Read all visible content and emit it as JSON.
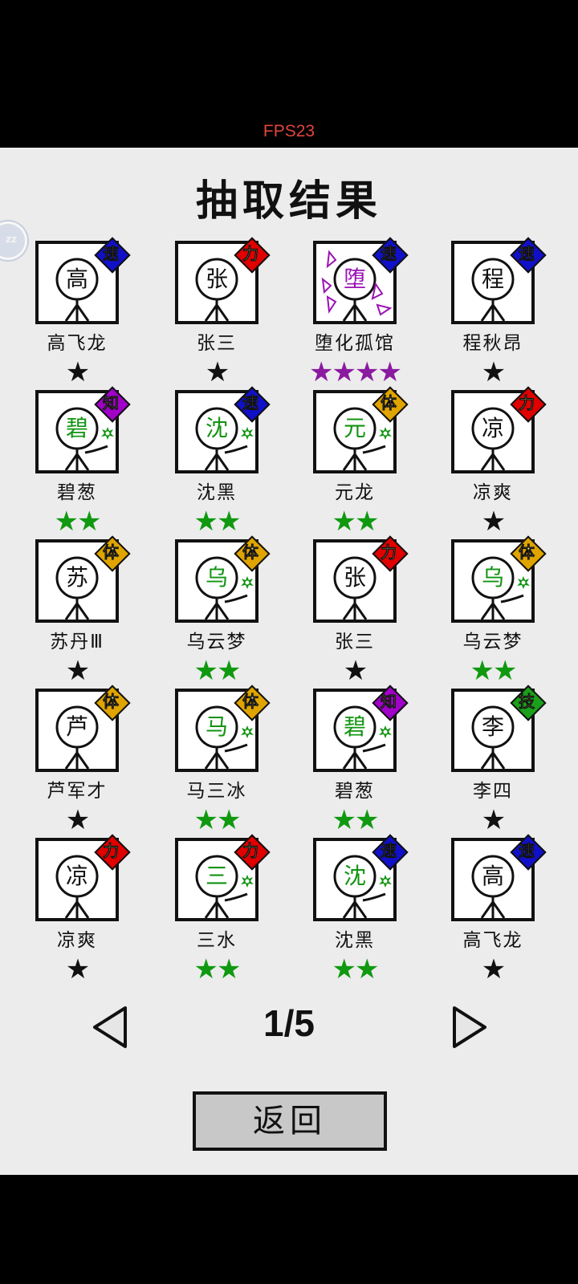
{
  "fps": "FPS23",
  "title": "抽取结果",
  "side_bubble": {
    "label": "zz"
  },
  "colors": {
    "power": "#e00000",
    "speed": "#1010c8",
    "body": "#e0a400",
    "wisdom": "#a000c8",
    "skill": "#1aa01a",
    "star_black": "#111111",
    "star_green": "#109910",
    "star_purple": "#8a1aa0",
    "face_black": "#111111",
    "face_green": "#129412",
    "face_purple": "#9a12b4"
  },
  "cards": [
    {
      "char": "高",
      "name": "高飞龙",
      "badge": "速",
      "badge_color": "speed",
      "stars": "★",
      "star_color": "star_black",
      "face_color": "face_black",
      "held": false,
      "fallen": false
    },
    {
      "char": "张",
      "name": "张三",
      "badge": "力",
      "badge_color": "power",
      "stars": "★",
      "star_color": "star_black",
      "face_color": "face_black",
      "held": false,
      "fallen": false
    },
    {
      "char": "堕",
      "name": "堕化孤馆",
      "badge": "速",
      "badge_color": "speed",
      "stars": "★★★★",
      "star_color": "star_purple",
      "face_color": "face_purple",
      "held": false,
      "fallen": true
    },
    {
      "char": "程",
      "name": "程秋昂",
      "badge": "速",
      "badge_color": "speed",
      "stars": "★",
      "star_color": "star_black",
      "face_color": "face_black",
      "held": false,
      "fallen": false
    },
    {
      "char": "碧",
      "name": "碧葱",
      "badge": "知",
      "badge_color": "wisdom",
      "stars": "★★",
      "star_color": "star_green",
      "face_color": "face_green",
      "held": true,
      "fallen": false
    },
    {
      "char": "沈",
      "name": "沈黑",
      "badge": "速",
      "badge_color": "speed",
      "stars": "★★",
      "star_color": "star_green",
      "face_color": "face_green",
      "held": true,
      "fallen": false
    },
    {
      "char": "元",
      "name": "元龙",
      "badge": "体",
      "badge_color": "body",
      "stars": "★★",
      "star_color": "star_green",
      "face_color": "face_green",
      "held": true,
      "fallen": false
    },
    {
      "char": "凉",
      "name": "凉爽",
      "badge": "力",
      "badge_color": "power",
      "stars": "★",
      "star_color": "star_black",
      "face_color": "face_black",
      "held": false,
      "fallen": false
    },
    {
      "char": "苏",
      "name": "苏丹Ⅲ",
      "badge": "体",
      "badge_color": "body",
      "stars": "★",
      "star_color": "star_black",
      "face_color": "face_black",
      "held": false,
      "fallen": false
    },
    {
      "char": "乌",
      "name": "乌云梦",
      "badge": "体",
      "badge_color": "body",
      "stars": "★★",
      "star_color": "star_green",
      "face_color": "face_green",
      "held": true,
      "fallen": false
    },
    {
      "char": "张",
      "name": "张三",
      "badge": "力",
      "badge_color": "power",
      "stars": "★",
      "star_color": "star_black",
      "face_color": "face_black",
      "held": false,
      "fallen": false
    },
    {
      "char": "乌",
      "name": "乌云梦",
      "badge": "体",
      "badge_color": "body",
      "stars": "★★",
      "star_color": "star_green",
      "face_color": "face_green",
      "held": true,
      "fallen": false
    },
    {
      "char": "芦",
      "name": "芦军才",
      "badge": "体",
      "badge_color": "body",
      "stars": "★",
      "star_color": "star_black",
      "face_color": "face_black",
      "held": false,
      "fallen": false
    },
    {
      "char": "马",
      "name": "马三冰",
      "badge": "体",
      "badge_color": "body",
      "stars": "★★",
      "star_color": "star_green",
      "face_color": "face_green",
      "held": true,
      "fallen": false
    },
    {
      "char": "碧",
      "name": "碧葱",
      "badge": "知",
      "badge_color": "wisdom",
      "stars": "★★",
      "star_color": "star_green",
      "face_color": "face_green",
      "held": true,
      "fallen": false
    },
    {
      "char": "李",
      "name": "李四",
      "badge": "技",
      "badge_color": "skill",
      "stars": "★",
      "star_color": "star_black",
      "face_color": "face_black",
      "held": false,
      "fallen": false
    },
    {
      "char": "凉",
      "name": "凉爽",
      "badge": "力",
      "badge_color": "power",
      "stars": "★",
      "star_color": "star_black",
      "face_color": "face_black",
      "held": false,
      "fallen": false
    },
    {
      "char": "三",
      "name": "三水",
      "badge": "力",
      "badge_color": "power",
      "stars": "★★",
      "star_color": "star_green",
      "face_color": "face_green",
      "held": true,
      "fallen": false
    },
    {
      "char": "沈",
      "name": "沈黑",
      "badge": "速",
      "badge_color": "speed",
      "stars": "★★",
      "star_color": "star_green",
      "face_color": "face_green",
      "held": true,
      "fallen": false
    },
    {
      "char": "高",
      "name": "高飞龙",
      "badge": "速",
      "badge_color": "speed",
      "stars": "★",
      "star_color": "star_black",
      "face_color": "face_black",
      "held": false,
      "fallen": false
    }
  ],
  "pager": {
    "page_label": "1/5"
  },
  "back_button": {
    "label": "返回"
  }
}
